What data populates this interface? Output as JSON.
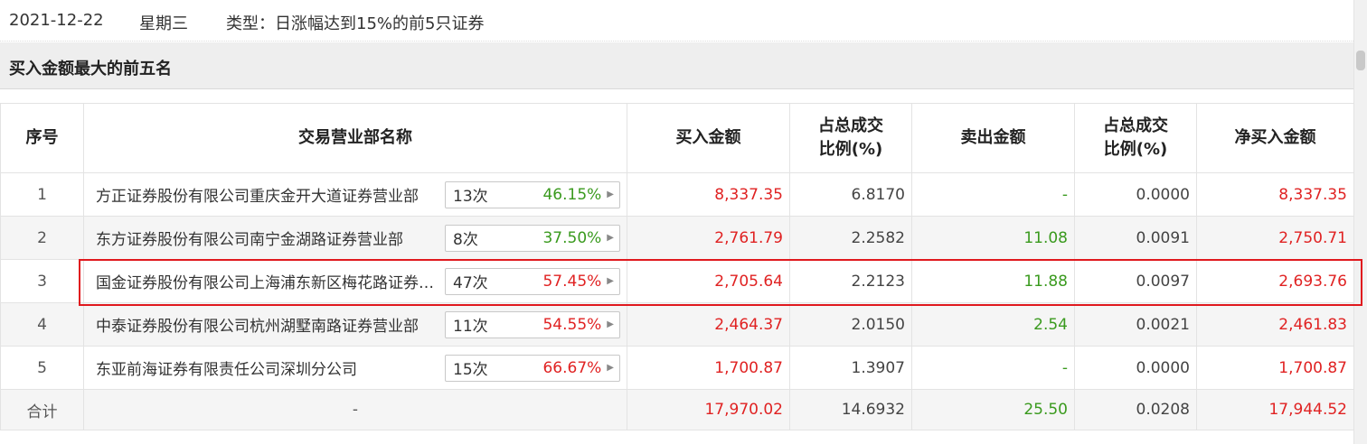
{
  "header": {
    "date": "2021-12-22",
    "weekday": "星期三",
    "type_text": "类型：日涨幅达到15%的前5只证券"
  },
  "section": {
    "title": "买入金额最大的前五名"
  },
  "table": {
    "columns": [
      "序号",
      "交易营业部名称",
      "买入金额",
      "占总成交\n比例(%)",
      "卖出金额",
      "占总成交\n比例(%)",
      "净买入金额"
    ],
    "rows": [
      {
        "idx": "1",
        "name": "方正证券股份有限公司重庆金开大道证券营业部",
        "times": "13次",
        "rate": "46.15%",
        "rate_color": "green",
        "buy": "8,337.35",
        "buy_pct": "6.8170",
        "sell": "-",
        "sell_pct": "0.0000",
        "net": "8,337.35"
      },
      {
        "idx": "2",
        "name": "东方证券股份有限公司南宁金湖路证券营业部",
        "times": "8次",
        "rate": "37.50%",
        "rate_color": "green",
        "buy": "2,761.79",
        "buy_pct": "2.2582",
        "sell": "11.08",
        "sell_pct": "0.0091",
        "net": "2,750.71"
      },
      {
        "idx": "3",
        "name": "国金证券股份有限公司上海浦东新区梅花路证券营业部",
        "times": "47次",
        "rate": "57.45%",
        "rate_color": "red",
        "buy": "2,705.64",
        "buy_pct": "2.2123",
        "sell": "11.88",
        "sell_pct": "0.0097",
        "net": "2,693.76"
      },
      {
        "idx": "4",
        "name": "中泰证券股份有限公司杭州湖墅南路证券营业部",
        "times": "11次",
        "rate": "54.55%",
        "rate_color": "red",
        "buy": "2,464.37",
        "buy_pct": "2.0150",
        "sell": "2.54",
        "sell_pct": "0.0021",
        "net": "2,461.83"
      },
      {
        "idx": "5",
        "name": "东亚前海证券有限责任公司深圳分公司",
        "times": "15次",
        "rate": "66.67%",
        "rate_color": "red",
        "buy": "1,700.87",
        "buy_pct": "1.3907",
        "sell": "-",
        "sell_pct": "0.0000",
        "net": "1,700.87"
      }
    ],
    "total": {
      "label": "合计",
      "name": "-",
      "buy": "17,970.02",
      "buy_pct": "14.6932",
      "sell": "25.50",
      "sell_pct": "0.0208",
      "net": "17,944.52"
    }
  },
  "icons": {
    "badge_arrow": "caret-right-icon"
  },
  "colors": {
    "positive": "#e02222",
    "negative": "#3a9a1e",
    "highlight_border": "#e0191e"
  }
}
